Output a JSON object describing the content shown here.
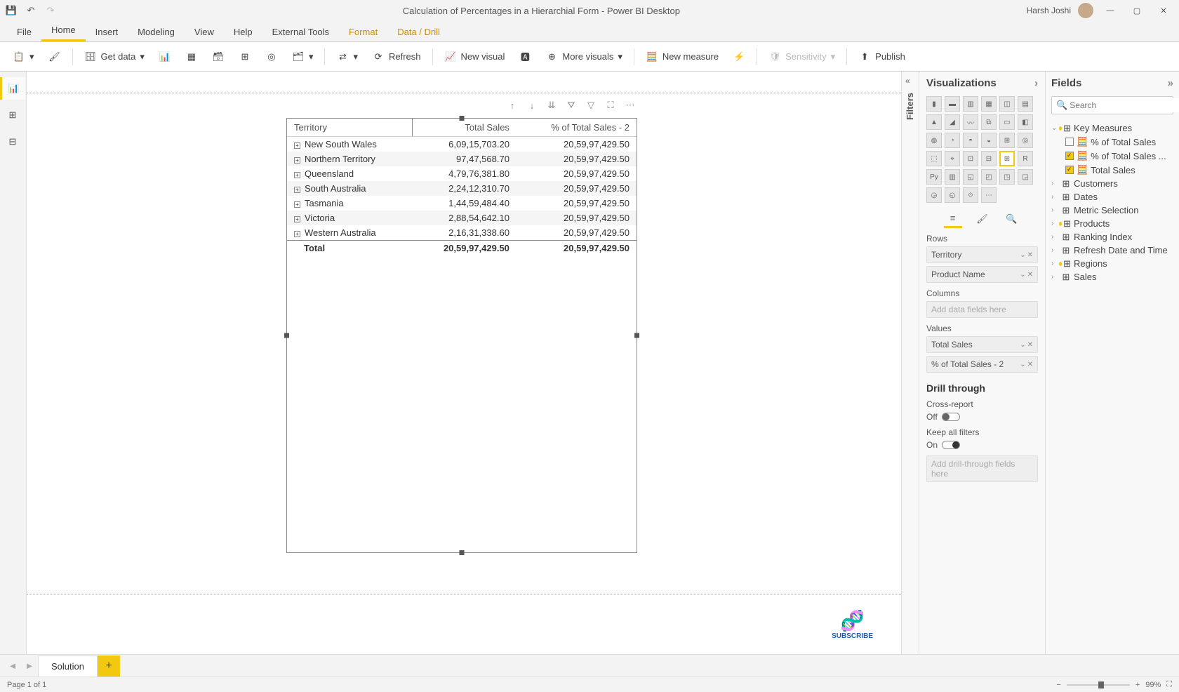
{
  "titlebar": {
    "title": "Calculation of Percentages in a Hierarchial Form - Power BI Desktop",
    "user": "Harsh Joshi"
  },
  "menu": {
    "items": [
      "File",
      "Home",
      "Insert",
      "Modeling",
      "View",
      "Help",
      "External Tools",
      "Format",
      "Data / Drill"
    ],
    "active": "Home"
  },
  "ribbon": {
    "get_data": "Get data",
    "refresh": "Refresh",
    "new_visual": "New visual",
    "more_visuals": "More visuals",
    "new_measure": "New measure",
    "sensitivity": "Sensitivity",
    "publish": "Publish"
  },
  "matrix": {
    "headers": [
      "Territory",
      "Total Sales",
      "% of Total Sales - 2"
    ],
    "rows": [
      {
        "territory": "New South Wales",
        "sales": "6,09,15,703.20",
        "pct": "20,59,97,429.50"
      },
      {
        "territory": "Northern Territory",
        "sales": "97,47,568.70",
        "pct": "20,59,97,429.50"
      },
      {
        "territory": "Queensland",
        "sales": "4,79,76,381.80",
        "pct": "20,59,97,429.50"
      },
      {
        "territory": "South Australia",
        "sales": "2,24,12,310.70",
        "pct": "20,59,97,429.50"
      },
      {
        "territory": "Tasmania",
        "sales": "1,44,59,484.40",
        "pct": "20,59,97,429.50"
      },
      {
        "territory": "Victoria",
        "sales": "2,88,54,642.10",
        "pct": "20,59,97,429.50"
      },
      {
        "territory": "Western Australia",
        "sales": "2,16,31,338.60",
        "pct": "20,59,97,429.50"
      }
    ],
    "total": {
      "label": "Total",
      "sales": "20,59,97,429.50",
      "pct": "20,59,97,429.50"
    }
  },
  "filters_label": "Filters",
  "viz": {
    "header": "Visualizations",
    "rows_label": "Rows",
    "rows": [
      "Territory",
      "Product Name"
    ],
    "columns_label": "Columns",
    "columns_placeholder": "Add data fields here",
    "values_label": "Values",
    "values": [
      "Total Sales",
      "% of Total Sales - 2"
    ],
    "drill_header": "Drill through",
    "cross_report": "Cross-report",
    "cross_report_state": "Off",
    "keep_filters": "Keep all filters",
    "keep_filters_state": "On",
    "drill_placeholder": "Add drill-through fields here"
  },
  "fields": {
    "header": "Fields",
    "search_placeholder": "Search",
    "tables": [
      {
        "name": "Key Measures",
        "expanded": true,
        "highlight": true,
        "children": [
          {
            "name": "% of Total Sales",
            "checked": false,
            "measure": true
          },
          {
            "name": "% of Total Sales ...",
            "checked": true,
            "measure": true
          },
          {
            "name": "Total Sales",
            "checked": true,
            "measure": true
          }
        ]
      },
      {
        "name": "Customers",
        "expanded": false
      },
      {
        "name": "Dates",
        "expanded": false
      },
      {
        "name": "Metric Selection",
        "expanded": false
      },
      {
        "name": "Products",
        "expanded": false,
        "highlight": true
      },
      {
        "name": "Ranking Index",
        "expanded": false
      },
      {
        "name": "Refresh Date and Time",
        "expanded": false
      },
      {
        "name": "Regions",
        "expanded": false,
        "highlight": true
      },
      {
        "name": "Sales",
        "expanded": false
      }
    ]
  },
  "bottom": {
    "page_tab": "Solution",
    "status": "Page 1 of 1",
    "zoom": "99%"
  },
  "subscribe": "SUBSCRIBE"
}
